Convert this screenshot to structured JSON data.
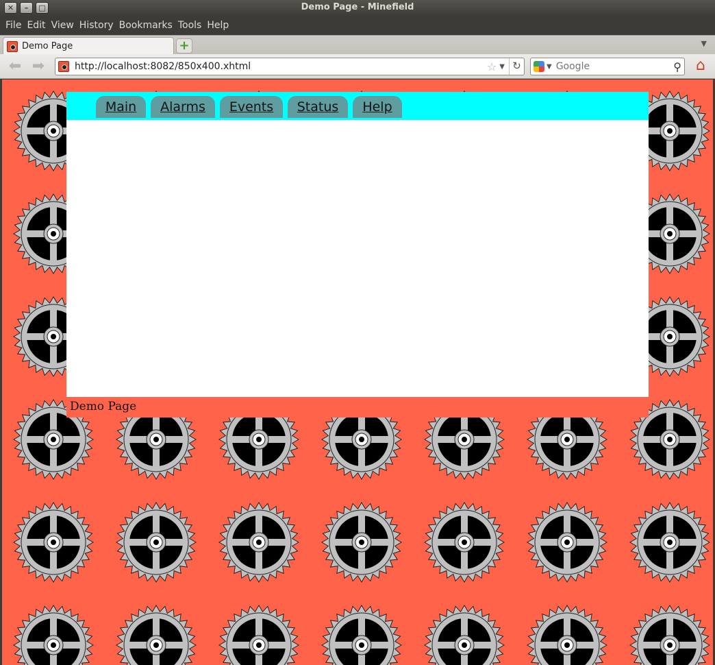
{
  "window": {
    "title": "Demo Page - Minefield",
    "controls": {
      "close": "✕",
      "minimize": "–",
      "maximize": "□"
    }
  },
  "menubar": {
    "items": [
      "File",
      "Edit",
      "View",
      "History",
      "Bookmarks",
      "Tools",
      "Help"
    ]
  },
  "tabs": [
    {
      "label": "Demo Page",
      "active": true
    }
  ],
  "newtab_icon": "add-tab-icon",
  "navbar": {
    "url": "http://localhost:8082/850x400.xhtml",
    "search_placeholder": "Google"
  },
  "page": {
    "nav": [
      "Main",
      "Alarms",
      "Events",
      "Status",
      "Help"
    ],
    "footer": "Demo Page",
    "colors": {
      "background": "#ff634a",
      "nav_strip": "#00ffff",
      "nav_tab": "#5f9ea0",
      "content": "#ffffff"
    }
  }
}
